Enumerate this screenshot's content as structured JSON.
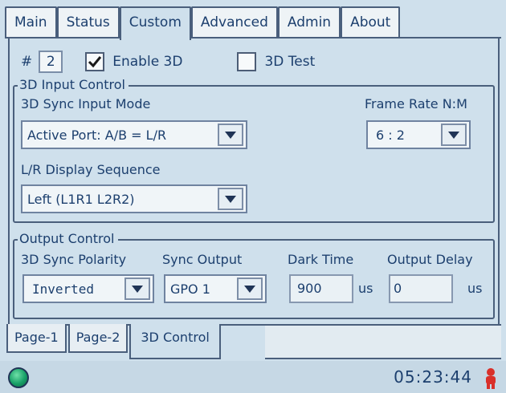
{
  "top_tabs": [
    "Main",
    "Status",
    "Custom",
    "Advanced",
    "Admin",
    "About"
  ],
  "active_top_tab": "Custom",
  "row1": {
    "hash_label": "#",
    "number_value": "2",
    "enable_3d_label": "Enable 3D",
    "enable_3d_checked": true,
    "test_3d_label": "3D Test",
    "test_3d_checked": false
  },
  "input_control": {
    "title": "3D Input Control",
    "sync_mode_label": "3D Sync Input Mode",
    "sync_mode_value": "Active Port: A/B = L/R",
    "frame_rate_label": "Frame Rate N:M",
    "frame_rate_value": "6 : 2",
    "lr_sequence_label": "L/R Display Sequence",
    "lr_sequence_value": "Left (L1R1 L2R2)"
  },
  "output_control": {
    "title": "Output Control",
    "polarity_label": "3D Sync Polarity",
    "polarity_value": "Inverted",
    "sync_output_label": "Sync Output",
    "sync_output_value": "GPO 1",
    "dark_time_label": "Dark Time",
    "dark_time_value": "900",
    "dark_time_unit": "us",
    "output_delay_label": "Output Delay",
    "output_delay_value": "0",
    "output_delay_unit": "us"
  },
  "page_tabs": [
    "Page-1",
    "Page-2",
    "3D Control"
  ],
  "active_page_tab": "3D Control",
  "status": {
    "time": "05:23:44",
    "led_color": "#17a067",
    "user_icon_color": "#d9302a"
  }
}
